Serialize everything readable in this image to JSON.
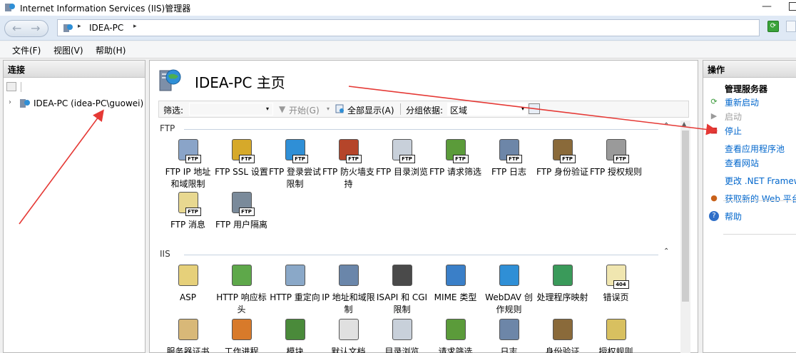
{
  "window": {
    "title": "Internet Information Services (IIS)管理器",
    "minimize_glyph": "—"
  },
  "address": {
    "crumb": "IDEA-PC",
    "sep_glyph": "▸",
    "back_glyph": "←",
    "forward_glyph": "→",
    "refresh_glyph": "⟳"
  },
  "menu": [
    "文件(F)",
    "视图(V)",
    "帮助(H)"
  ],
  "left": {
    "header": "连接",
    "tree": {
      "expander": "›",
      "label": "IDEA-PC (idea-PC\\guowei)"
    }
  },
  "main": {
    "title": "IDEA-PC 主页",
    "filter": {
      "label": "筛选:",
      "dropdown_glyph": "▾",
      "start_glyph": "▼",
      "start": "开始(G)",
      "show_all": "全部显示(A)",
      "group_by": "分组依据:",
      "group_value": "区域"
    },
    "groups": [
      {
        "title": "FTP",
        "collapse_glyph": "⌃"
      },
      {
        "title": "IIS",
        "collapse_glyph": "⌃"
      }
    ],
    "ftp_features": [
      {
        "label": "FTP IP 地址和域限制",
        "icon": "ftp-ip-restrictions-icon",
        "tag": "FTP",
        "color": "#8aa4c8"
      },
      {
        "label": "FTP SSL 设置",
        "icon": "ftp-ssl-lock-icon",
        "tag": "FTP",
        "color": "#d6a92a"
      },
      {
        "label": "FTP 登录尝试限制",
        "icon": "ftp-logon-globe-icon",
        "tag": "FTP",
        "color": "#2f8fd6"
      },
      {
        "label": "FTP 防火墙支持",
        "icon": "ftp-firewall-icon",
        "tag": "FTP",
        "color": "#b5452a"
      },
      {
        "label": "FTP 目录浏览",
        "icon": "ftp-directory-browsing-icon",
        "tag": "FTP",
        "color": "#c8d0da"
      },
      {
        "label": "FTP 请求筛选",
        "icon": "ftp-request-filtering-icon",
        "tag": "FTP",
        "color": "#5b9b3a"
      },
      {
        "label": "FTP 日志",
        "icon": "ftp-logging-icon",
        "tag": "FTP",
        "color": "#6d86a8"
      },
      {
        "label": "FTP 身份验证",
        "icon": "ftp-authentication-icon",
        "tag": "FTP",
        "color": "#8a6a3a"
      },
      {
        "label": "FTP 授权规则",
        "icon": "ftp-authorization-key-icon",
        "tag": "FTP",
        "color": "#9a9a9a"
      },
      {
        "label": "FTP 消息",
        "icon": "ftp-messages-icon",
        "tag": "FTP",
        "color": "#e8d890"
      },
      {
        "label": "FTP 用户隔离",
        "icon": "ftp-user-isolation-icon",
        "tag": "FTP",
        "color": "#7a8a9a"
      }
    ],
    "iis_features": [
      {
        "label": "ASP",
        "icon": "asp-icon",
        "tag": "",
        "color": "#e6d07a"
      },
      {
        "label": "HTTP 响应标头",
        "icon": "http-response-headers-icon",
        "tag": "",
        "color": "#5ea84a"
      },
      {
        "label": "HTTP 重定向",
        "icon": "http-redirect-icon",
        "tag": "",
        "color": "#8aa8c8"
      },
      {
        "label": "IP 地址和域限制",
        "icon": "ip-domain-restrictions-icon",
        "tag": "",
        "color": "#6a86aa"
      },
      {
        "label": "ISAPI 和 CGI 限制",
        "icon": "isapi-cgi-icon",
        "tag": "",
        "color": "#4a4a4a"
      },
      {
        "label": "MIME 类型",
        "icon": "mime-types-icon",
        "tag": "",
        "color": "#3a7fc8"
      },
      {
        "label": "WebDAV 创作规则",
        "icon": "webdav-icon",
        "tag": "",
        "color": "#2f8fd6"
      },
      {
        "label": "处理程序映射",
        "icon": "handler-mappings-icon",
        "tag": "",
        "color": "#3a9a5a"
      },
      {
        "label": "错误页",
        "icon": "error-pages-icon",
        "tag": "404",
        "color": "#f0e6b0"
      },
      {
        "label": "服务器证书",
        "icon": "server-certificates-icon",
        "tag": "",
        "color": "#d8b878"
      },
      {
        "label": "工作进程",
        "icon": "worker-processes-icon",
        "tag": "",
        "color": "#d87a2a"
      },
      {
        "label": "模块",
        "icon": "modules-icon",
        "tag": "",
        "color": "#4a8a3a"
      },
      {
        "label": "默认文档",
        "icon": "default-document-icon",
        "tag": "",
        "color": "#e0e0e0"
      },
      {
        "label": "目录浏览",
        "icon": "directory-browsing-icon",
        "tag": "",
        "color": "#c8d0da"
      },
      {
        "label": "请求筛选",
        "icon": "request-filtering-icon",
        "tag": "",
        "color": "#5b9b3a"
      },
      {
        "label": "日志",
        "icon": "logging-icon",
        "tag": "",
        "color": "#6d86a8"
      },
      {
        "label": "身份验证",
        "icon": "authentication-icon",
        "tag": "",
        "color": "#8a6a3a"
      },
      {
        "label": "授权规则",
        "icon": "authorization-rules-icon",
        "tag": "",
        "color": "#d8c060"
      }
    ]
  },
  "actions": {
    "header": "操作",
    "section": "管理服务器",
    "items": [
      {
        "label": "重新启动",
        "icon": "restart-icon",
        "glyph": "⟳",
        "state": "link"
      },
      {
        "label": "启动",
        "icon": "start-icon",
        "glyph": "▶",
        "state": "disabled"
      },
      {
        "label": "停止",
        "icon": "stop-icon",
        "glyph": "■",
        "state": "link"
      },
      {
        "label": "查看应用程序池",
        "icon": "",
        "glyph": "",
        "state": "link"
      },
      {
        "label": "查看网站",
        "icon": "",
        "glyph": "",
        "state": "link"
      },
      {
        "label": "更改 .NET Framework",
        "icon": "",
        "glyph": "",
        "state": "link"
      },
      {
        "label": "获取新的 Web 平台",
        "icon": "web-platform-icon",
        "glyph": "●",
        "state": "link"
      },
      {
        "label": "帮助",
        "icon": "help-icon",
        "glyph": "?",
        "state": "link"
      }
    ]
  },
  "colors": {
    "link": "#0066cc",
    "annotation": "#e53935",
    "address_bg": "#dfe9f5"
  }
}
